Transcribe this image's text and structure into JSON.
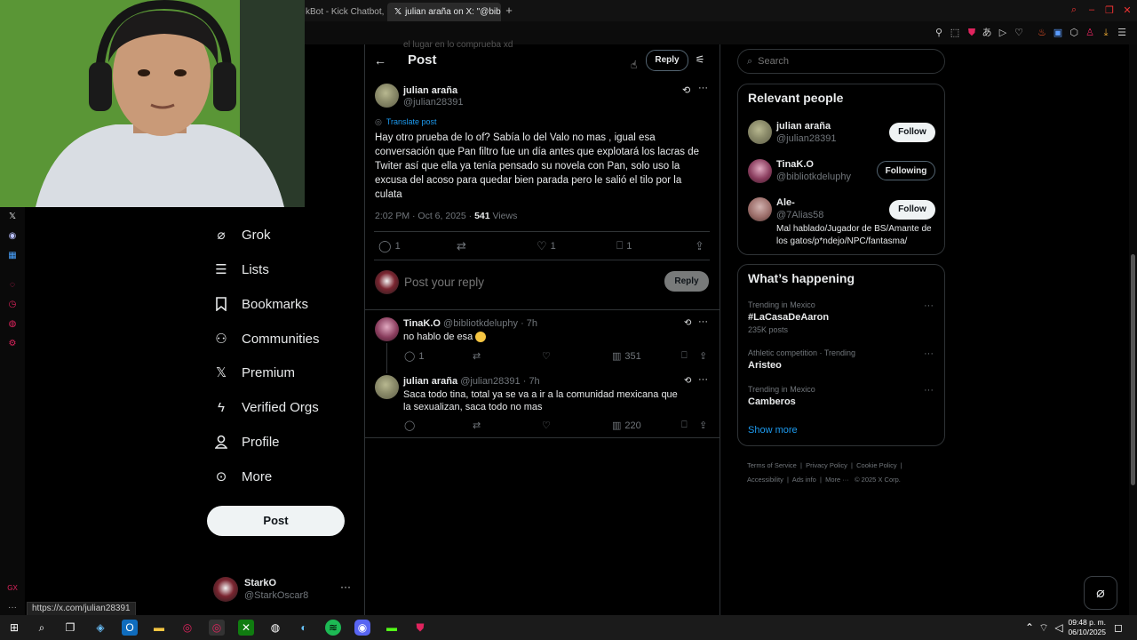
{
  "browser": {
    "tabs": [
      {
        "label": "kBot - Kick Chatbot, A"
      },
      {
        "label": "julian araña on X: \"@bibli"
      }
    ],
    "new_tab": "+",
    "status_url": "https://x.com/julian28391"
  },
  "nav": {
    "items": [
      {
        "label": "Grok",
        "icon": "grok-icon"
      },
      {
        "label": "Lists",
        "icon": "lists-icon"
      },
      {
        "label": "Bookmarks",
        "icon": "bookmark-icon"
      },
      {
        "label": "Communities",
        "icon": "communities-icon"
      },
      {
        "label": "Premium",
        "icon": "x-logo-icon"
      },
      {
        "label": "Verified Orgs",
        "icon": "lightning-icon"
      },
      {
        "label": "Profile",
        "icon": "person-icon"
      },
      {
        "label": "More",
        "icon": "more-circle-icon"
      }
    ],
    "post_button": "Post",
    "account": {
      "name": "StarkO",
      "handle": "@StarkOscar8"
    }
  },
  "header": {
    "title": "Post",
    "reply_button": "Reply",
    "peek_text": "el lugar en lo comprueba xd"
  },
  "main_post": {
    "author": "julian araña",
    "handle": "@julian28391",
    "translate": "Translate post",
    "text": "Hay otro prueba de lo of? Sabía lo del Valo no mas , igual esa conversación que Pan filtro fue un día antes que explotará los lacras de Twiter así que ella ya tenía pensado su novela con Pan, solo uso la excusa del acoso para quedar bien parada pero le salió el tilo por la culata",
    "time": "2:02 PM · Oct 6, 2025 · ",
    "views": "541",
    "views_label": " Views",
    "replies": "1",
    "likes": "1",
    "bookmarks": "1"
  },
  "composer": {
    "placeholder": "Post your reply",
    "button": "Reply"
  },
  "replies": [
    {
      "author": "TinaK.O",
      "handle": "@bibliotkdeluphy",
      "time": "· 7h",
      "text": "no hablo de esa",
      "replies": "1",
      "views": "351"
    },
    {
      "author": "julian araña",
      "handle": "@julian28391",
      "time": "· 7h",
      "text": "Saca todo tina, total ya se va a ir a la comunidad mexicana que la sexualizan, saca todo no mas",
      "views": "220"
    }
  ],
  "search": {
    "placeholder": "Search"
  },
  "relevant": {
    "title": "Relevant people",
    "people": [
      {
        "name": "julian araña",
        "handle": "@julian28391",
        "button": "Follow",
        "bio": ""
      },
      {
        "name": "TinaK.O",
        "handle": "@bibliotkdeluphy",
        "button": "Following",
        "bio": ""
      },
      {
        "name": "Ale-",
        "handle": "@7Alias58",
        "button": "Follow",
        "bio": "Mal hablado/Jugador de BS/Amante de los gatos/p*ndejo/NPC/fantasma/"
      }
    ]
  },
  "happening": {
    "title": "What’s happening",
    "trends": [
      {
        "context": "Trending in Mexico",
        "name": "#LaCasaDeAaron",
        "posts": "235K posts"
      },
      {
        "context": "Athletic competition · Trending",
        "name": "Aristeo",
        "posts": ""
      },
      {
        "context": "Trending in Mexico",
        "name": "Camberos",
        "posts": ""
      }
    ],
    "show_more": "Show more"
  },
  "footer": {
    "links": [
      "Terms of Service",
      "Privacy Policy",
      "Cookie Policy",
      "Accessibility",
      "Ads info",
      "More ···",
      "© 2025 X Corp."
    ]
  },
  "taskbar": {
    "time": "09:48 p. m.",
    "date": "06/10/2025"
  },
  "colors": {
    "background": "#000000",
    "accent_blue": "#1d9bf0",
    "text_primary": "#e7e9ea",
    "text_secondary": "#71767b",
    "border": "#2f3336",
    "x_tab_badge": "#e0245e"
  }
}
